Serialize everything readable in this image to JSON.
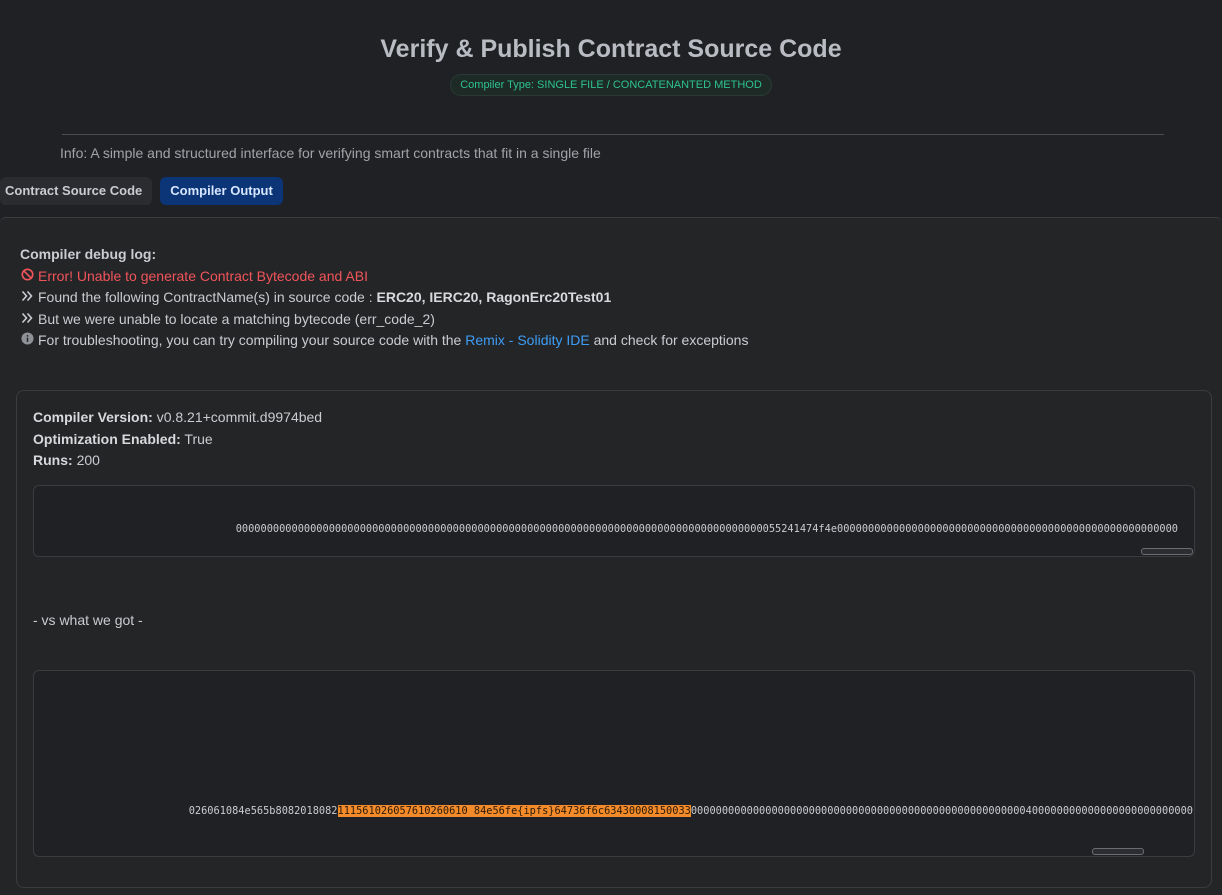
{
  "page": {
    "title": "Verify & Publish Contract Source Code",
    "compiler_type": "Compiler Type: SINGLE FILE / CONCATENANTED METHOD",
    "info": "Info: A simple and structured interface for verifying smart contracts that fit in a single file"
  },
  "tabs": [
    {
      "label": "Contract Source Code",
      "active": false
    },
    {
      "label": "Compiler Output",
      "active": true
    }
  ],
  "log": {
    "heading": "Compiler debug log:",
    "error": "Error! Unable to generate Contract Bytecode and ABI",
    "found_prefix": "Found the following ContractName(s) in source code :",
    "found_names": "ERC20, IERC20, RagonErc20Test01",
    "bytecode_msg": "But we were unable to locate a matching bytecode (err_code_2)",
    "trouble_prefix": "For troubleshooting, you can try compiling your source code with the",
    "trouble_link": "Remix - Solidity IDE",
    "trouble_suffix": "and check for exceptions"
  },
  "details": {
    "version_label": "Compiler Version:",
    "version_value": "v0.8.21+commit.d9974bed",
    "opt_label": "Optimization Enabled:",
    "opt_value": "True",
    "runs_label": "Runs:",
    "runs_value": "200"
  },
  "expected_bytecode": "0000000000000000000000000000000000000000000000000000000000000000000000000000000000000055241474f4e0000000000000000000000000000000000000000000000000000000",
  "vs_label": "- vs what we got -",
  "got_bytecode": {
    "before": "026061084e565b8082018082",
    "highlight": "111561026057610260610 84e56fe{ipfs}64736f6c63430008150033",
    "after": "000000000000000000000000000000000000000000000000000000400000000000000000000000000"
  },
  "colors": {
    "accent_blue": "#0b3577",
    "error_red": "#f2545b",
    "link_blue": "#3d9df6",
    "badge_green": "#2ec28f",
    "highlight_orange": "#f48b2a"
  },
  "icons": {
    "error": "ban-icon",
    "arrow": "double-chevron-right-icon",
    "info": "info-circle-icon"
  }
}
